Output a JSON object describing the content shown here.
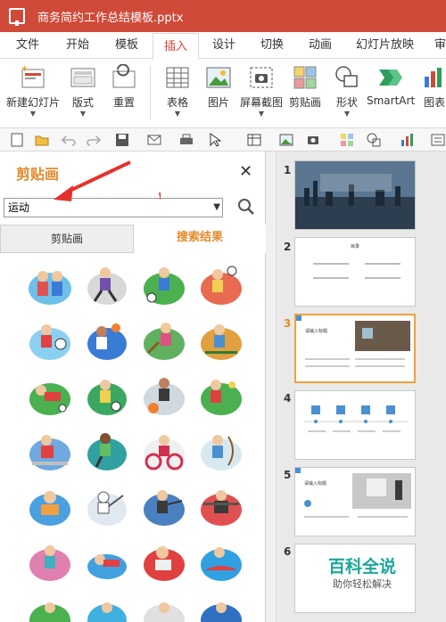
{
  "window": {
    "title": "商务简约工作总结模板.pptx"
  },
  "menu": [
    "文件",
    "开始",
    "模板",
    "插入",
    "设计",
    "切换",
    "动画",
    "幻灯片放映",
    "审"
  ],
  "ribbon": {
    "new_slide": "新建幻灯片",
    "layout": "版式",
    "reset": "重置",
    "table": "表格",
    "picture": "图片",
    "screenshot": "屏幕截图",
    "clipart": "剪贴画",
    "shapes": "形状",
    "smartart": "SmartArt",
    "chart": "图表"
  },
  "pane": {
    "title": "剪贴画",
    "search_value": "运动",
    "tab_clipart": "剪贴画",
    "tab_results": "搜索结果"
  },
  "thumbnails": [
    "1",
    "2",
    "3",
    "4",
    "5",
    "6"
  ],
  "slide2_title": "目录",
  "slide3_title": "请输入标题",
  "slide5_title": "请输入标题",
  "watermark": {
    "title": "百科全说",
    "subtitle": "助你轻松解决"
  },
  "colors": {
    "brand": "#d04a39",
    "accent": "#e38a2b",
    "watermark": "#1aa89a"
  }
}
